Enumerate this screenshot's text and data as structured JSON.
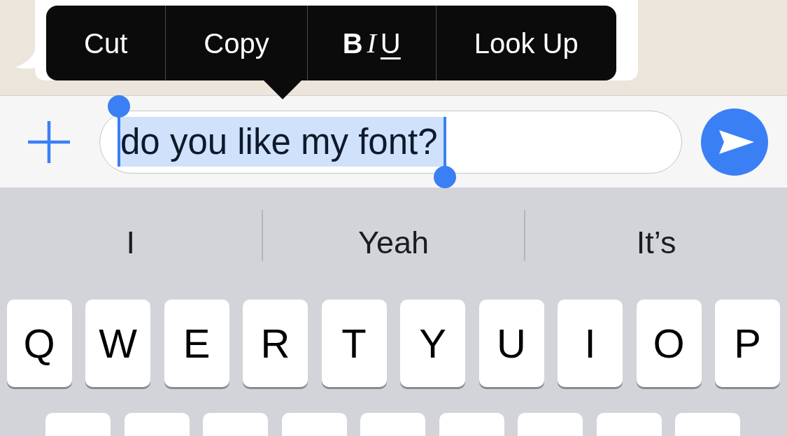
{
  "edit_menu": {
    "items": [
      {
        "kind": "text",
        "label": "Cut"
      },
      {
        "kind": "text",
        "label": "Copy"
      },
      {
        "kind": "format",
        "bold": "B",
        "italic": "I",
        "underline": "U"
      },
      {
        "kind": "text",
        "label": "Look Up"
      }
    ]
  },
  "composer": {
    "field": {
      "value": "do you like my font?",
      "text_selected": true
    }
  },
  "keyboard": {
    "suggestions": [
      {
        "label": "I"
      },
      {
        "label": "Yeah"
      },
      {
        "label": "It’s"
      }
    ],
    "top_row": [
      "Q",
      "W",
      "E",
      "R",
      "T",
      "Y",
      "U",
      "I",
      "O",
      "P"
    ]
  }
}
